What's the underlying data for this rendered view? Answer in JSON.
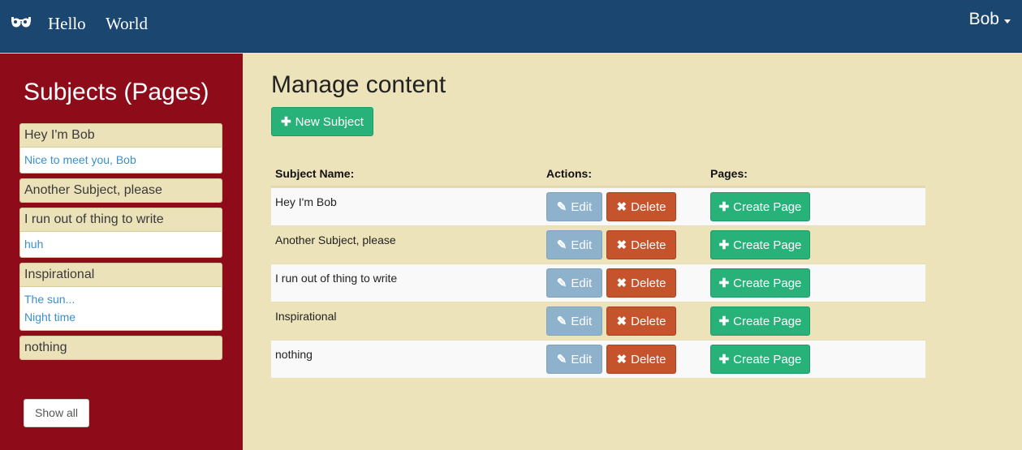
{
  "navbar": {
    "brand_icon": "glasses-icon",
    "links": [
      "Hello",
      "World"
    ],
    "user": "Bob"
  },
  "sidebar": {
    "title": "Subjects (Pages)",
    "subjects": [
      {
        "name": "Hey I'm Bob",
        "pages": [
          "Nice to meet you, Bob"
        ]
      },
      {
        "name": "Another Subject, please",
        "pages": []
      },
      {
        "name": "I run out of thing to write",
        "pages": [
          "huh"
        ]
      },
      {
        "name": "Inspirational",
        "pages": [
          "The sun...",
          "Night time"
        ]
      },
      {
        "name": "nothing",
        "pages": []
      }
    ],
    "show_all_label": "Show all"
  },
  "main": {
    "heading": "Manage content",
    "new_subject_label": "New Subject",
    "table": {
      "headers": [
        "Subject Name:",
        "Actions:",
        "Pages:"
      ],
      "rows": [
        {
          "name": "Hey I'm Bob"
        },
        {
          "name": "Another Subject, please"
        },
        {
          "name": "I run out of thing to write"
        },
        {
          "name": "Inspirational"
        },
        {
          "name": "nothing"
        }
      ],
      "edit_label": "Edit",
      "delete_label": "Delete",
      "create_label": "Create Page"
    }
  },
  "colors": {
    "navbar": "#1b4670",
    "sidebar": "#8e0c1a",
    "content_bg": "#ede3bb",
    "success": "#28b27a",
    "danger": "#c5532b",
    "info": "#8fb2cc",
    "link": "#3a8fcc"
  }
}
